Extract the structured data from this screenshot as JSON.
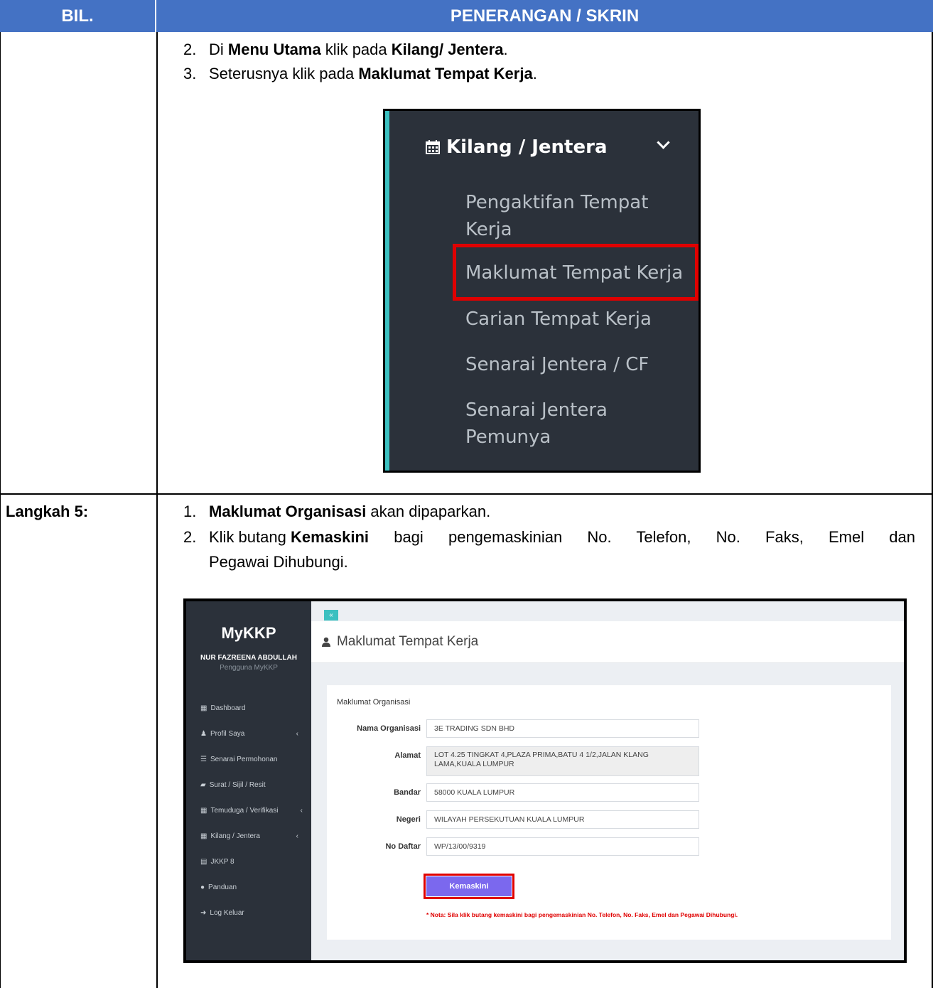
{
  "table": {
    "header_bil": "BIL.",
    "header_penerangan": "PENERANGAN / SKRIN"
  },
  "row1": {
    "step2_num": "2.",
    "step2_a": "Di ",
    "step2_b": "Menu Utama",
    "step2_c": " klik pada ",
    "step2_d": "Kilang/ Jentera",
    "step2_e": ".",
    "step3_num": "3.",
    "step3_a": "Seterusnya klik pada ",
    "step3_b": "Maklumat Tempat Kerja",
    "step3_c": "."
  },
  "menu_screenshot": {
    "title": "Kilang / Jentera",
    "items": [
      "Pengaktifan Tempat Kerja",
      "Maklumat Tempat Kerja",
      "Carian Tempat Kerja",
      "Senarai Jentera / CF",
      "Senarai Jentera Pemunya"
    ],
    "highlighted_item": "Maklumat Tempat Kerja"
  },
  "row2": {
    "label": "Langkah 5:",
    "step1_num": "1.",
    "step1_b": "Maklumat Organisasi",
    "step1_c": " akan dipaparkan.",
    "step2_num": "2.",
    "step2_a": "Klik butang ",
    "step2_b": "Kemaskini",
    "step2_c": " bagi pengemaskinian No. Telefon, No. Faks, Emel dan",
    "step2_d": "Pegawai Dihubungi."
  },
  "app": {
    "toggle": "«",
    "brand": "MyKKP",
    "user_name": "NUR FAZREENA ABDULLAH",
    "user_role": "Pengguna MyKKP",
    "nav": [
      {
        "label": "Dashboard",
        "icon": "▦",
        "arrow": ""
      },
      {
        "label": "Profil Saya",
        "icon": "♟",
        "arrow": "‹"
      },
      {
        "label": "Senarai Permohonan",
        "icon": "☰",
        "arrow": ""
      },
      {
        "label": "Surat / Sijil / Resit",
        "icon": "▰",
        "arrow": ""
      },
      {
        "label": "Temuduga / Verifikasi",
        "icon": "▦",
        "arrow": "‹"
      },
      {
        "label": "Kilang / Jentera",
        "icon": "▦",
        "arrow": "‹"
      },
      {
        "label": "JKKP 8",
        "icon": "▤",
        "arrow": ""
      },
      {
        "label": "Panduan",
        "icon": "●",
        "arrow": ""
      },
      {
        "label": "Log Keluar",
        "icon": "➜",
        "arrow": ""
      }
    ],
    "page_title": "Maklumat Tempat Kerja",
    "panel_title": "Maklumat Organisasi",
    "fields": {
      "nama_label": "Nama Organisasi",
      "nama_value": "3E TRADING SDN BHD",
      "alamat_label": "Alamat",
      "alamat_value": "LOT 4.25 TINGKAT 4,PLAZA PRIMA,BATU 4 1/2,JALAN KLANG LAMA,KUALA LUMPUR",
      "bandar_label": "Bandar",
      "bandar_value": "58000 KUALA LUMPUR",
      "negeri_label": "Negeri",
      "negeri_value": "WILAYAH PERSEKUTUAN KUALA LUMPUR",
      "nodaftar_label": "No Daftar",
      "nodaftar_value": "WP/13/00/9319"
    },
    "button_label": "Kemaskini",
    "nota": "* Nota: Sila klik butang kemaskini bagi pengemaskinian No. Telefon, No. Faks, Emel dan Pegawai Dihubungi."
  },
  "colors": {
    "header_bg": "#4472c4",
    "sidebar_bg": "#2b313a",
    "accent_teal": "#3cc0c0",
    "highlight_red": "#e00000",
    "button_purple": "#7b68ee"
  }
}
